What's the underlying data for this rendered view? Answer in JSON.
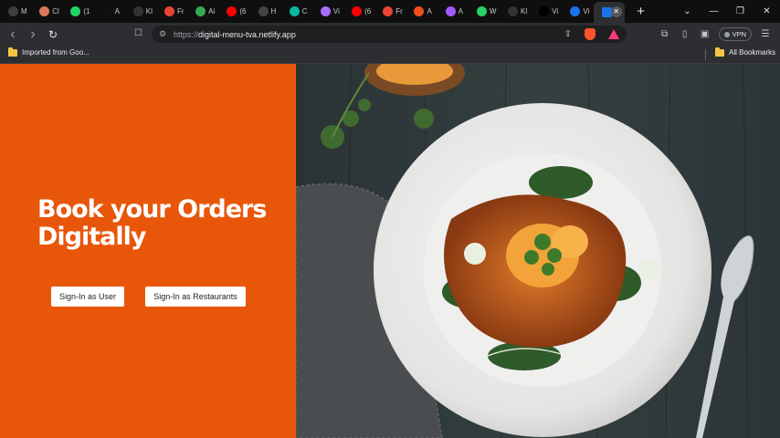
{
  "tabs": [
    {
      "label": "M",
      "icon": "chrome-icon",
      "color": "#3c4043"
    },
    {
      "label": "Cl",
      "icon": "claude-icon",
      "color": "#d97757"
    },
    {
      "label": "(1",
      "icon": "whatsapp-icon",
      "color": "#25d366"
    },
    {
      "label": "A",
      "icon": "ai-icon",
      "color": "#111111"
    },
    {
      "label": "Kl",
      "icon": "github-icon",
      "color": "#333333"
    },
    {
      "label": "Fr",
      "icon": "gmail-icon",
      "color": "#ea4335"
    },
    {
      "label": "Ai",
      "icon": "spark-icon",
      "color": "#34a853"
    },
    {
      "label": "(6",
      "icon": "youtube-icon",
      "color": "#ff0000"
    },
    {
      "label": "H",
      "icon": "notion-icon",
      "color": "#444444"
    },
    {
      "label": "C",
      "icon": "codeium-icon",
      "color": "#09b6a2"
    },
    {
      "label": "Vi",
      "icon": "vite-icon",
      "color": "#a96cff"
    },
    {
      "label": "(6",
      "icon": "youtube-icon",
      "color": "#ff0000"
    },
    {
      "label": "Fr",
      "icon": "gmail-icon",
      "color": "#ea4335"
    },
    {
      "label": "A",
      "icon": "figma-icon",
      "color": "#f24e1e"
    },
    {
      "label": "A",
      "icon": "figma-icon",
      "color": "#a259ff"
    },
    {
      "label": "W",
      "icon": "whatsapp-icon",
      "color": "#25d366"
    },
    {
      "label": "Kl",
      "icon": "github-icon",
      "color": "#333333"
    },
    {
      "label": "Vi",
      "icon": "vercel-icon",
      "color": "#000000"
    },
    {
      "label": "Vi",
      "icon": "docs-icon",
      "color": "#1a73e8"
    }
  ],
  "active_tab": {
    "label": "Vi",
    "close_glyph": "✕"
  },
  "newtab_glyph": "+",
  "window": {
    "minimize": "—",
    "restore": "❐",
    "close": "✕",
    "dropdown": "⌄"
  },
  "toolbar": {
    "back": "‹",
    "forward": "›",
    "reload": "↻",
    "bookmark": "☐",
    "url_scheme": "https://",
    "url_host": "digital-menu-tva.netlify.app",
    "vpn_label": "VPN",
    "menu": "☰"
  },
  "bookmarks": {
    "left_label": "Imported from Goo...",
    "right_label": "All Bookmarks"
  },
  "hero": {
    "headline": "Book your Orders Digitally",
    "signin_user": "Sign-In as User",
    "signin_restaurant": "Sign-In as Restaurants"
  },
  "colors": {
    "accent": "#e8560a",
    "button_bg": "#ffffff",
    "button_text": "#222222"
  }
}
